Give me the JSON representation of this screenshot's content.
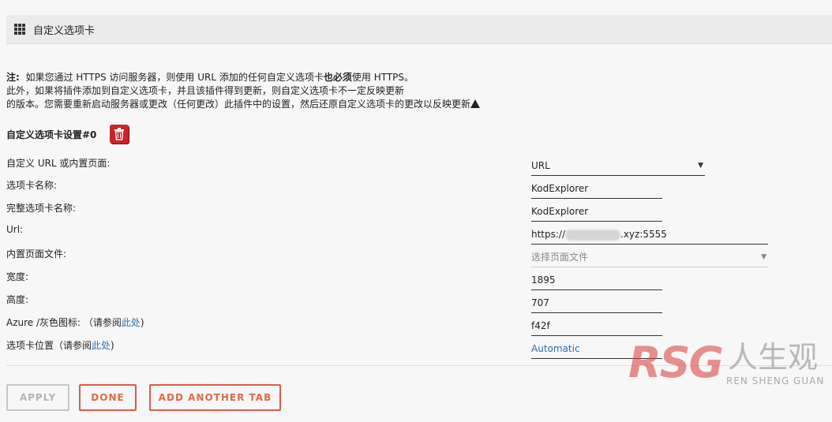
{
  "header": {
    "title": "自定义选项卡",
    "icon": "grid-icon"
  },
  "notice": {
    "prefix": "注:",
    "line1_a": "如果您通过 HTTPS 访问服务器，则使用 URL 添加的任何自定义选项卡",
    "line1_bold": "也必须",
    "line1_b": "使用 HTTPS。",
    "line2": "此外，如果将插件添加到自定义选项卡，并且该插件得到更新，则自定义选项卡不一定反映更新",
    "line3": "的版本。您需要重新启动服务器或更改（任何更改）此插件中的设置，然后还原自定义选项卡的更改以反映更新"
  },
  "settings": {
    "title": "自定义选项卡设置#0",
    "rows": {
      "url_type": {
        "label": "自定义 URL 或内置页面:",
        "value": "URL"
      },
      "tab_name": {
        "label": "选项卡名称:",
        "value": "KodExplorer"
      },
      "full_tab_name": {
        "label": "完整选项卡名称:",
        "value": "KodExplorer"
      },
      "url": {
        "label": "Url:",
        "value_prefix": "https://",
        "value_suffix": ".xyz:5555"
      },
      "builtin_page": {
        "label": "内置页面文件:",
        "placeholder": "选择页面文件"
      },
      "width": {
        "label": "宽度:",
        "value": "1895"
      },
      "height": {
        "label": "高度:",
        "value": "707"
      },
      "azure_icon": {
        "label": "Azure /灰色图标: （请参阅",
        "link": "此处",
        "suffix": ")",
        "value": "f42f"
      },
      "tab_position": {
        "label": "选项卡位置（请参阅",
        "link": "此处",
        "suffix": ")",
        "value": "Automatic"
      }
    }
  },
  "buttons": {
    "apply": "APPLY",
    "done": "DONE",
    "add_tab": "ADD ANOTHER TAB"
  },
  "watermark": {
    "logo": "RSG",
    "cn": "人生观",
    "en": "REN SHENG GUAN"
  }
}
